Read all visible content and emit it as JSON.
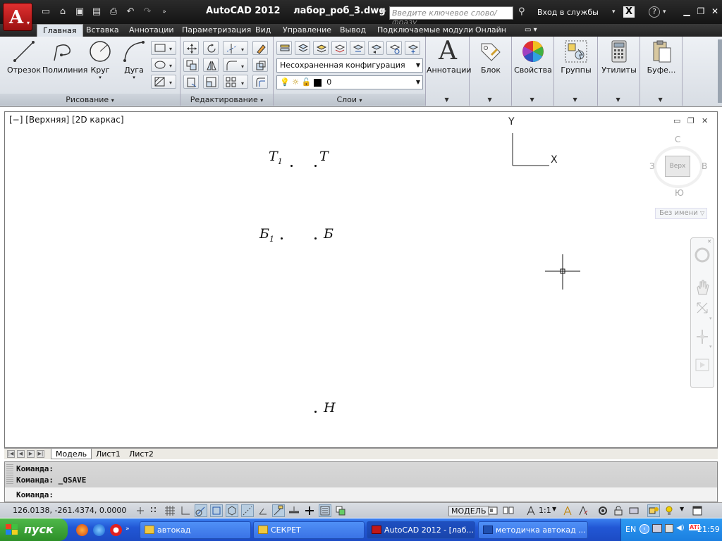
{
  "titlebar": {
    "app_name": "AutoCAD 2012",
    "file_name": "лабор_роб_3.dwg",
    "search_placeholder": "Введите ключевое слово/фразу",
    "login_label": "Вход в службы"
  },
  "ribbon_tabs": [
    "Главная",
    "Вставка",
    "Аннотации",
    "Параметризация",
    "Вид",
    "Управление",
    "Вывод",
    "Подключаемые модули",
    "Онлайн"
  ],
  "ribbon": {
    "draw": {
      "title": "Рисование",
      "line": "Отрезок",
      "polyline": "Полилиния",
      "circle": "Круг",
      "arc": "Дуга"
    },
    "modify": {
      "title": "Редактирование"
    },
    "layers": {
      "title": "Слои",
      "state_combo": "Несохраненная конфигурация слоев",
      "layer_combo": "0"
    },
    "annotations": "Аннотации",
    "block": "Блок",
    "properties": "Свойства",
    "groups": "Группы",
    "utilities": "Утилиты",
    "clipboard": "Буфе..."
  },
  "viewport": {
    "label": "[−] [Верхняя] [2D каркас]",
    "ucs_x": "X",
    "ucs_y": "Y",
    "viewcube": {
      "north": "С",
      "south": "Ю",
      "west": "З",
      "east": "В",
      "face": "Верх",
      "ucs_menu": "Без имени"
    },
    "points": [
      {
        "label": "Т",
        "sub": "1"
      },
      {
        "label": "Т",
        "sub": ""
      },
      {
        "label": "Б",
        "sub": "1"
      },
      {
        "label": "Б",
        "sub": ""
      },
      {
        "label": "Н",
        "sub": ""
      }
    ]
  },
  "layout_tabs": [
    "Модель",
    "Лист1",
    "Лист2"
  ],
  "command": {
    "history": [
      "Команда:",
      "Команда:  _QSAVE"
    ],
    "prompt": "Команда:"
  },
  "statusbar": {
    "coords": "126.0138, -261.4374, 0.0000",
    "model_label": "МОДЕЛЬ",
    "scale": "1:1"
  },
  "taskbar": {
    "start_label": "пуск",
    "tasks": [
      "автокад",
      "СЕКРЕТ",
      "AutoCAD 2012 - [лаб...",
      "методичка автокад ..."
    ],
    "lang": "EN",
    "clock": "21:59"
  },
  "colors": {
    "accent_red": "#c01818",
    "ribbon_bg": "#e4e8ee",
    "taskbar_blue": "#2257d5",
    "start_green": "#3a9e34"
  }
}
